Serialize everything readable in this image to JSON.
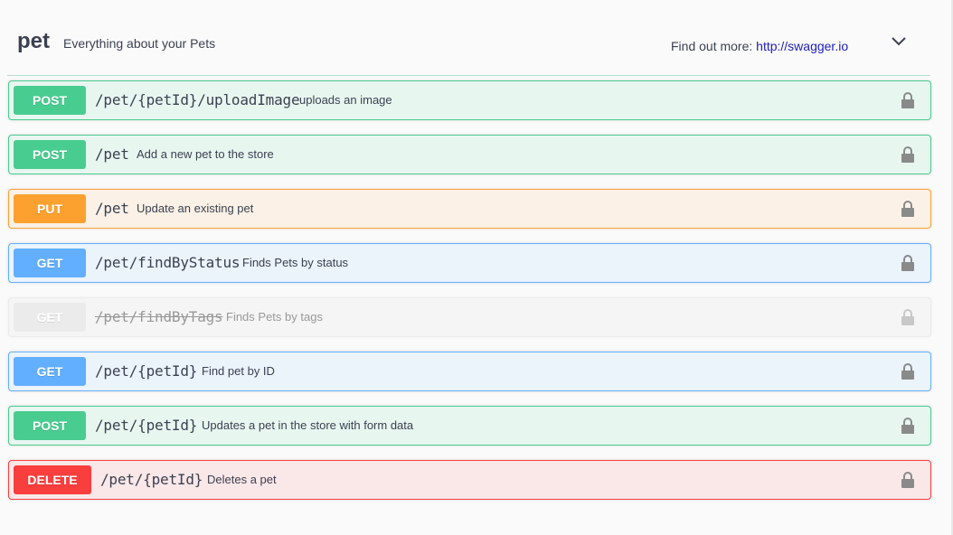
{
  "tag": {
    "name": "pet",
    "description": "Everything about your Pets",
    "find_more_label": "Find out more:",
    "find_more_link": "http://swagger.io",
    "chevron_icon": "chevron-down-icon"
  },
  "operations": [
    {
      "method": "POST",
      "path": "/pet/{petId}/uploadImage",
      "summary": "uploads an image",
      "deprecated": false
    },
    {
      "method": "POST",
      "path": "/pet",
      "summary": "Add a new pet to the store",
      "deprecated": false
    },
    {
      "method": "PUT",
      "path": "/pet",
      "summary": "Update an existing pet",
      "deprecated": false
    },
    {
      "method": "GET",
      "path": "/pet/findByStatus",
      "summary": "Finds Pets by status",
      "deprecated": false
    },
    {
      "method": "GET",
      "path": "/pet/findByTags",
      "summary": "Finds Pets by tags",
      "deprecated": true
    },
    {
      "method": "GET",
      "path": "/pet/{petId}",
      "summary": "Find pet by ID",
      "deprecated": false
    },
    {
      "method": "POST",
      "path": "/pet/{petId}",
      "summary": "Updates a pet in the store with form data",
      "deprecated": false
    },
    {
      "method": "DELETE",
      "path": "/pet/{petId}",
      "summary": "Deletes a pet",
      "deprecated": false
    }
  ],
  "icons": {
    "lock": "lock-icon"
  },
  "colors": {
    "post": "#49cc90",
    "put": "#fca130",
    "get": "#61affe",
    "delete": "#f93e3e",
    "deprecated": "#ebebeb",
    "link": "#1d1dbd"
  }
}
